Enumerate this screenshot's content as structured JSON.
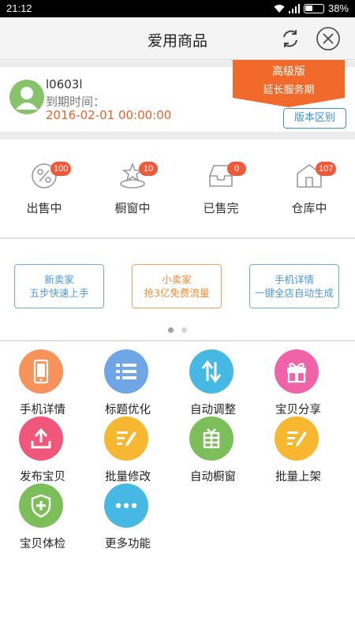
{
  "status_bar": {
    "time": "21:12",
    "battery": "38%"
  },
  "header": {
    "title": "爱用商品",
    "refresh_icon": "refresh-icon",
    "close_icon": "close-icon"
  },
  "account": {
    "username": "l0603l",
    "expire_label": "到期时间：",
    "expire_date": "2016-02-01 00:00:00",
    "ribbon_title": "高级版",
    "ribbon_subtitle": "延长服务期",
    "version_button": "版本区别"
  },
  "stats": [
    {
      "label": "出售中",
      "badge": "100",
      "icon": "percent-tag-icon"
    },
    {
      "label": "橱窗中",
      "badge": "10",
      "icon": "star-showcase-icon"
    },
    {
      "label": "已售完",
      "badge": "0",
      "icon": "inbox-tray-icon"
    },
    {
      "label": "仓库中",
      "badge": "107",
      "icon": "warehouse-icon"
    }
  ],
  "promos": [
    {
      "line1": "新卖家",
      "line2": "五步快速上手"
    },
    {
      "line1": "小卖家",
      "line2": "抢3亿免费流量"
    },
    {
      "line1": "手机详情",
      "line2": "一键全店自动生成"
    }
  ],
  "tools": [
    {
      "label": "手机详情",
      "icon": "phone-icon",
      "color": "#f7935a"
    },
    {
      "label": "标题优化",
      "icon": "list-icon",
      "color": "#6fa6e6"
    },
    {
      "label": "自动调整",
      "icon": "up-down-arrows-icon",
      "color": "#45b9e3"
    },
    {
      "label": "宝贝分享",
      "icon": "gift-icon",
      "color": "#f063a8"
    },
    {
      "label": "发布宝贝",
      "icon": "upload-icon",
      "color": "#f0577a"
    },
    {
      "label": "批量修改",
      "icon": "edit-list-icon",
      "color": "#f7b731"
    },
    {
      "label": "自动橱窗",
      "icon": "showcase-icon",
      "color": "#7cbf5a"
    },
    {
      "label": "批量上架",
      "icon": "edit-list-icon",
      "color": "#f7b731"
    },
    {
      "label": "宝贝体检",
      "icon": "shield-plus-icon",
      "color": "#7cbf5a"
    },
    {
      "label": "更多功能",
      "icon": "more-dots-icon",
      "color": "#45b9e3"
    }
  ]
}
